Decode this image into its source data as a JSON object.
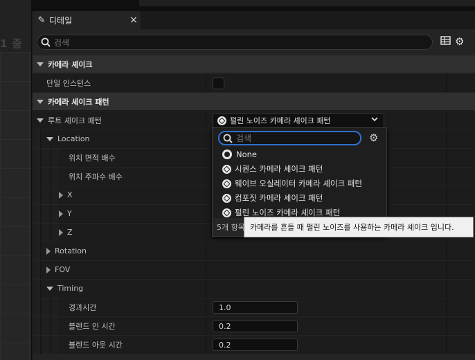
{
  "background": {
    "zoom_fragment": "1 줌"
  },
  "tab": {
    "title": "디테일",
    "close": "×"
  },
  "search": {
    "placeholder": "검색"
  },
  "sections": {
    "camera_shake": "카메라 셰이크",
    "single_instance": "단일 인스턴스",
    "shake_pattern": "카메라 셰이크 패턴",
    "root_shake_pattern": "루트 셰이크 패턴",
    "location": "Location",
    "position_amplitude": "위치 면적 배수",
    "position_frequency": "위치 주파수 배수",
    "x": "X",
    "y": "Y",
    "z": "Z",
    "rotation": "Rotation",
    "fov": "FOV",
    "timing": "Timing",
    "elapsed_time": "경과시간",
    "blend_in_time": "블렌드 인 시간",
    "blend_out_time": "블렌드 아웃 시간"
  },
  "values": {
    "root_shake_pattern": "펄린 노이즈 카메라 셰이크 패턴",
    "elapsed_time": "1.0",
    "blend_in_time": "0.2",
    "blend_out_time": "0.2",
    "single_instance_checked": false
  },
  "dropdown": {
    "search_placeholder": "검색",
    "items": [
      {
        "label": "None",
        "icon": "none-circle-icon"
      },
      {
        "label": "시퀀스 카메라 셰이크 패턴",
        "icon": "class-icon"
      },
      {
        "label": "웨이브 오실레이터 카메라 셰이크 패턴",
        "icon": "class-icon"
      },
      {
        "label": "컴포짓 카메라 셰이크 패턴",
        "icon": "class-icon"
      },
      {
        "label": "펄린 노이즈 카메라 셰이크 패턴",
        "icon": "class-icon"
      }
    ],
    "footer": "5개 항목"
  },
  "tooltip": "카메라를 흔들 때 펄린 노이즈를 사용하는 카메라 셰이크 입니다.",
  "colors": {
    "accent": "#2f6fd0",
    "panel": "#242424",
    "category": "#303030"
  }
}
